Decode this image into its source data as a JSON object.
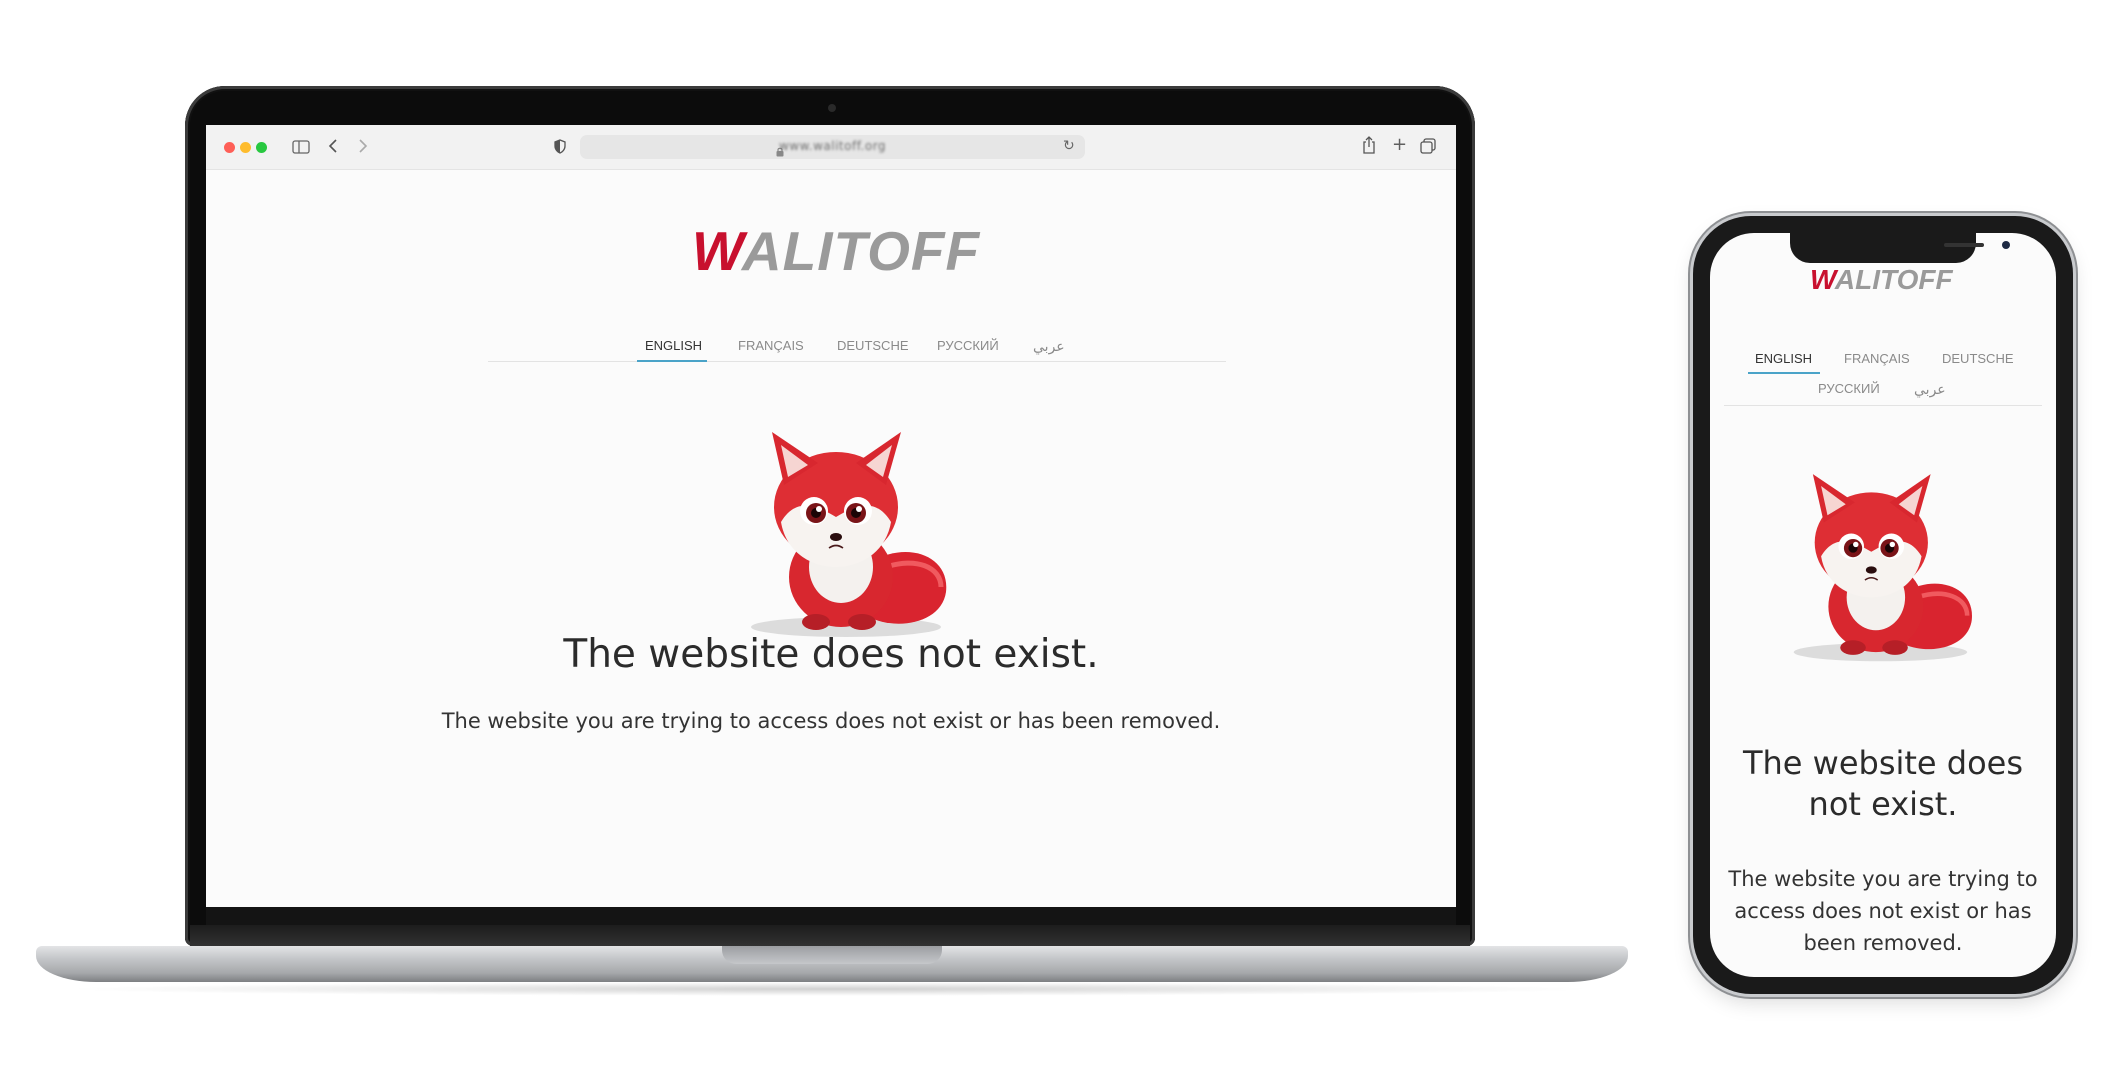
{
  "browser": {
    "url": "www.walitoff.org",
    "icons": [
      "sidebar-icon",
      "back-icon",
      "forward-icon",
      "shield-icon",
      "lock-icon",
      "reload-icon",
      "share-icon",
      "new-tab-icon",
      "tabs-overview-icon"
    ]
  },
  "brand": {
    "logo_first_letter": "W",
    "logo_rest": "ALITOFF",
    "accent_color": "#c8102e",
    "logo_gray": "#9a9a9a"
  },
  "languages": [
    {
      "label": "ENGLISH",
      "active": true
    },
    {
      "label": "FRANÇAIS",
      "active": false
    },
    {
      "label": "DEUTSCHE",
      "active": false
    },
    {
      "label": "РУССКИЙ",
      "active": false
    },
    {
      "label": "عربي",
      "active": false
    }
  ],
  "message": {
    "title": "The website does not exist.",
    "body": "The website you are trying to access does not exist or has been removed."
  },
  "illustration": {
    "name": "red-fox-mascot"
  }
}
